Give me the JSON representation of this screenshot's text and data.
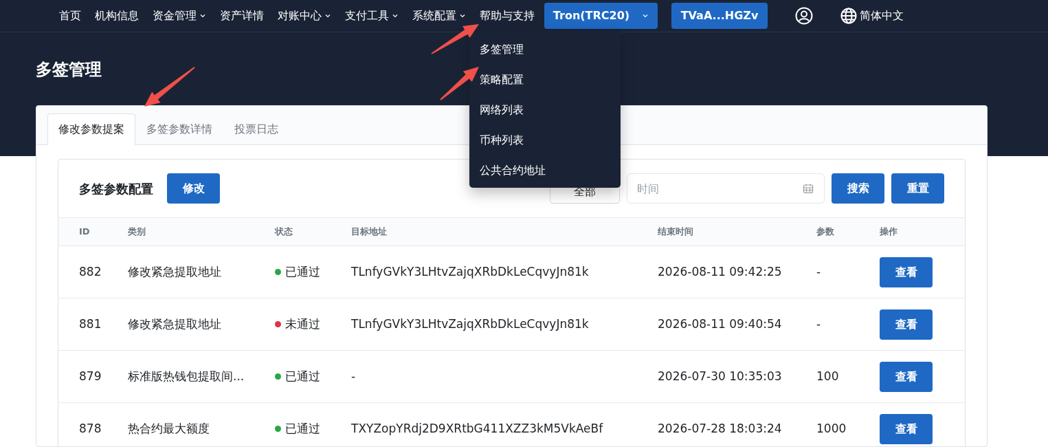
{
  "nav": {
    "items": [
      {
        "label": "首页",
        "kind": "link"
      },
      {
        "label": "机构信息",
        "kind": "link"
      },
      {
        "label": "资金管理",
        "kind": "dropdown"
      },
      {
        "label": "资产详情",
        "kind": "link"
      },
      {
        "label": "对账中心",
        "kind": "dropdown"
      },
      {
        "label": "支付工具",
        "kind": "dropdown"
      },
      {
        "label": "系统配置",
        "kind": "dropdown"
      },
      {
        "label": "帮助与支持",
        "kind": "link"
      }
    ],
    "network_button": "Tron(TRC20)",
    "wallet_button": "TVaA...HGZv",
    "language": "简体中文"
  },
  "dropdown_menu": {
    "items": [
      "多签管理",
      "策略配置",
      "网络列表",
      "币种列表",
      "公共合约地址"
    ]
  },
  "page_title": "多签管理",
  "tabs": [
    {
      "label": "修改参数提案",
      "selected": true
    },
    {
      "label": "多签参数详情",
      "selected": false
    },
    {
      "label": "投票日志",
      "selected": false
    }
  ],
  "panel": {
    "title": "多签参数配置",
    "edit_button": "修改",
    "filter_select": "全部",
    "time_placeholder": "时间",
    "search_button": "搜索",
    "reset_button": "重置"
  },
  "table": {
    "columns": [
      "ID",
      "类别",
      "状态",
      "目标地址",
      "结束时间",
      "参数",
      "操作"
    ],
    "rows": [
      {
        "id": "882",
        "category": "修改紧急提取地址",
        "status": "已通过",
        "color": "#28a745",
        "address": "TLnfyGVkY3LHtvZajqXRbDkLeCqvyJn81k",
        "end_time": "2026-08-11 09:42:25",
        "param": "-",
        "action": "查看"
      },
      {
        "id": "881",
        "category": "修改紧急提取地址",
        "status": "未通过",
        "color": "#dc3545",
        "address": "TLnfyGVkY3LHtvZajqXRbDkLeCqvyJn81k",
        "end_time": "2026-08-11 09:40:54",
        "param": "-",
        "action": "查看"
      },
      {
        "id": "879",
        "category": "标准版热钱包提取间...",
        "status": "已通过",
        "color": "#28a745",
        "address": "-",
        "end_time": "2026-07-30 10:35:03",
        "param": "100",
        "action": "查看"
      },
      {
        "id": "878",
        "category": "热合约最大额度",
        "status": "已通过",
        "color": "#28a745",
        "address": "TXYZopYRdj2D9XRtbG411XZZ3kM5VkAeBf",
        "end_time": "2026-07-28 18:03:24",
        "param": "1000",
        "action": "查看"
      }
    ]
  }
}
